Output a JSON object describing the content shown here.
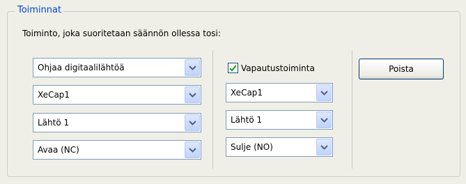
{
  "group": {
    "title": "Toiminnat"
  },
  "instruction": "Toiminto, joka suoritetaan säännön ollessa tosi:",
  "left_column": {
    "action": "Ohjaa digitaalilähtöä",
    "device": "XeCap1",
    "output": "Lähtö 1",
    "state": "Avaa (NC)"
  },
  "release": {
    "checkbox_label": "Vapautustoiminta",
    "checked": true,
    "device": "XeCap1",
    "output": "Lähtö 1",
    "state": "Sulje (NO)"
  },
  "delete_button": "Poista",
  "colors": {
    "title": "#0046d5",
    "checkmark": "#21a121",
    "arrow": "#4d6185"
  }
}
